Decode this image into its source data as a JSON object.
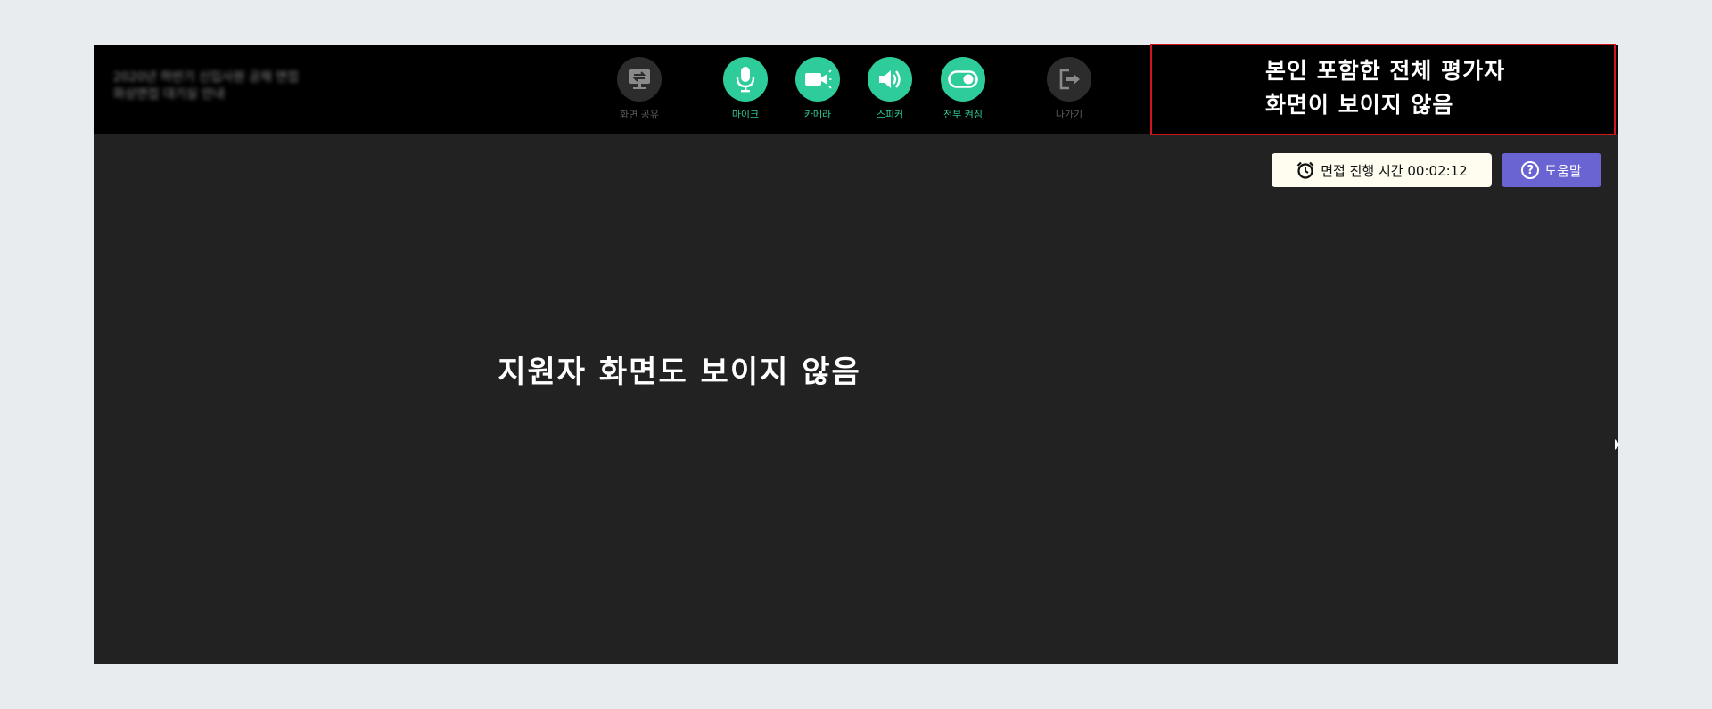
{
  "header": {
    "title_line1": "2020년 하반기 신입사원 공채 면접",
    "title_line2": "화상면접 대기실 안내"
  },
  "controls": [
    {
      "id": "share",
      "label": "화면 공유",
      "icon": "screen-share-icon",
      "state": "off"
    },
    {
      "id": "mic",
      "label": "마이크",
      "icon": "microphone-icon",
      "state": "on"
    },
    {
      "id": "camera",
      "label": "카메라",
      "icon": "video-camera-icon",
      "state": "on"
    },
    {
      "id": "speaker",
      "label": "스피커",
      "icon": "speaker-icon",
      "state": "on"
    },
    {
      "id": "all_on",
      "label": "전부 켜짐",
      "icon": "toggle-icon",
      "state": "on"
    },
    {
      "id": "leave",
      "label": "나가기",
      "icon": "exit-icon",
      "state": "off"
    }
  ],
  "annotation": {
    "line1": "본인 포함한 전체 평가자",
    "line2": "화면이 보이지 않음"
  },
  "timer": {
    "label": "면접 진행 시간 00:02:12",
    "icon": "alarm-clock-icon"
  },
  "help": {
    "label": "도움말",
    "icon": "question-circle-icon"
  },
  "main": {
    "message": "지원자 화면도 보이지 않음"
  },
  "colors": {
    "accent_green": "#2ecc9a",
    "help_purple": "#6a63d2",
    "annotation_red": "#d2141e",
    "stage_bg": "#222222",
    "topbar_bg": "#000000"
  }
}
